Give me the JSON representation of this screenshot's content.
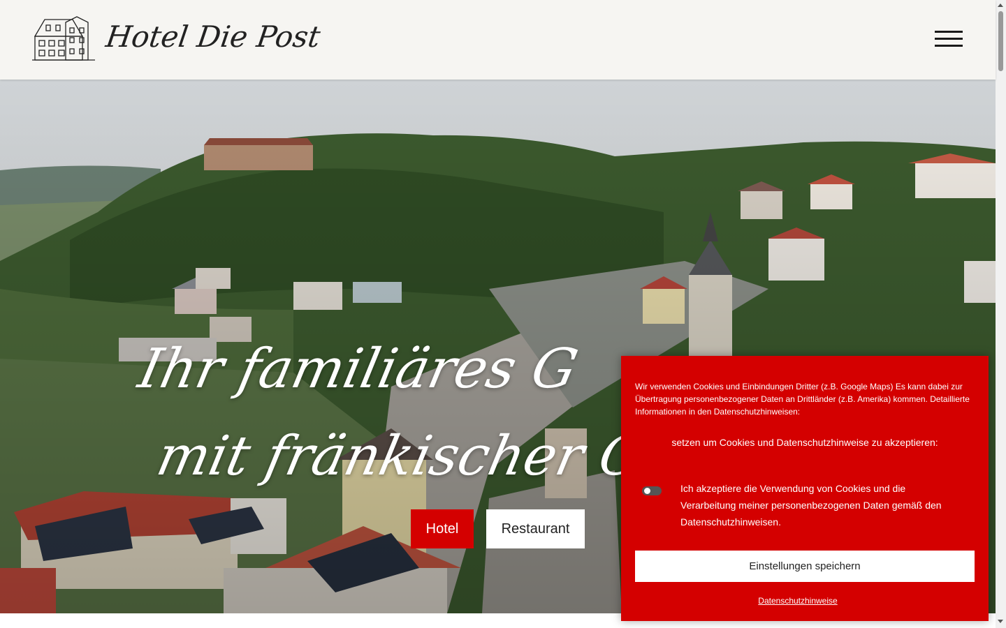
{
  "header": {
    "brand": "Hotel Die Post",
    "logo_icon": "hotel-building-sketch-icon",
    "menu_icon": "hamburger-menu-icon"
  },
  "hero": {
    "title_line1": "Ihr familiäres G",
    "title_line2": "mit fränkischer C",
    "buttons": {
      "hotel": "Hotel",
      "restaurant": "Restaurant"
    }
  },
  "cookie_banner": {
    "text": "Wir verwenden Cookies und Einbindungen Dritter (z.B. Google Maps) Es kann dabei zur Übertragung personenbezogener Daten an Drittländer (z.B. Amerika) kommen. Detaillierte Informationen in den Datenschutzhinweisen:",
    "subtitle": "setzen um Cookies und Datenschutzhinweise zu akzeptieren:",
    "consent_label": "Ich akzeptiere die Verwendung von Cookies und die Verarbeitung meiner personenbezogenen Daten gemäß den Datenschutzhinweisen.",
    "save_button": "Einstellungen speichern",
    "privacy_link": "Datenschutzhinweise"
  },
  "colors": {
    "accent": "#d40000",
    "header_bg": "#f6f5f2"
  }
}
